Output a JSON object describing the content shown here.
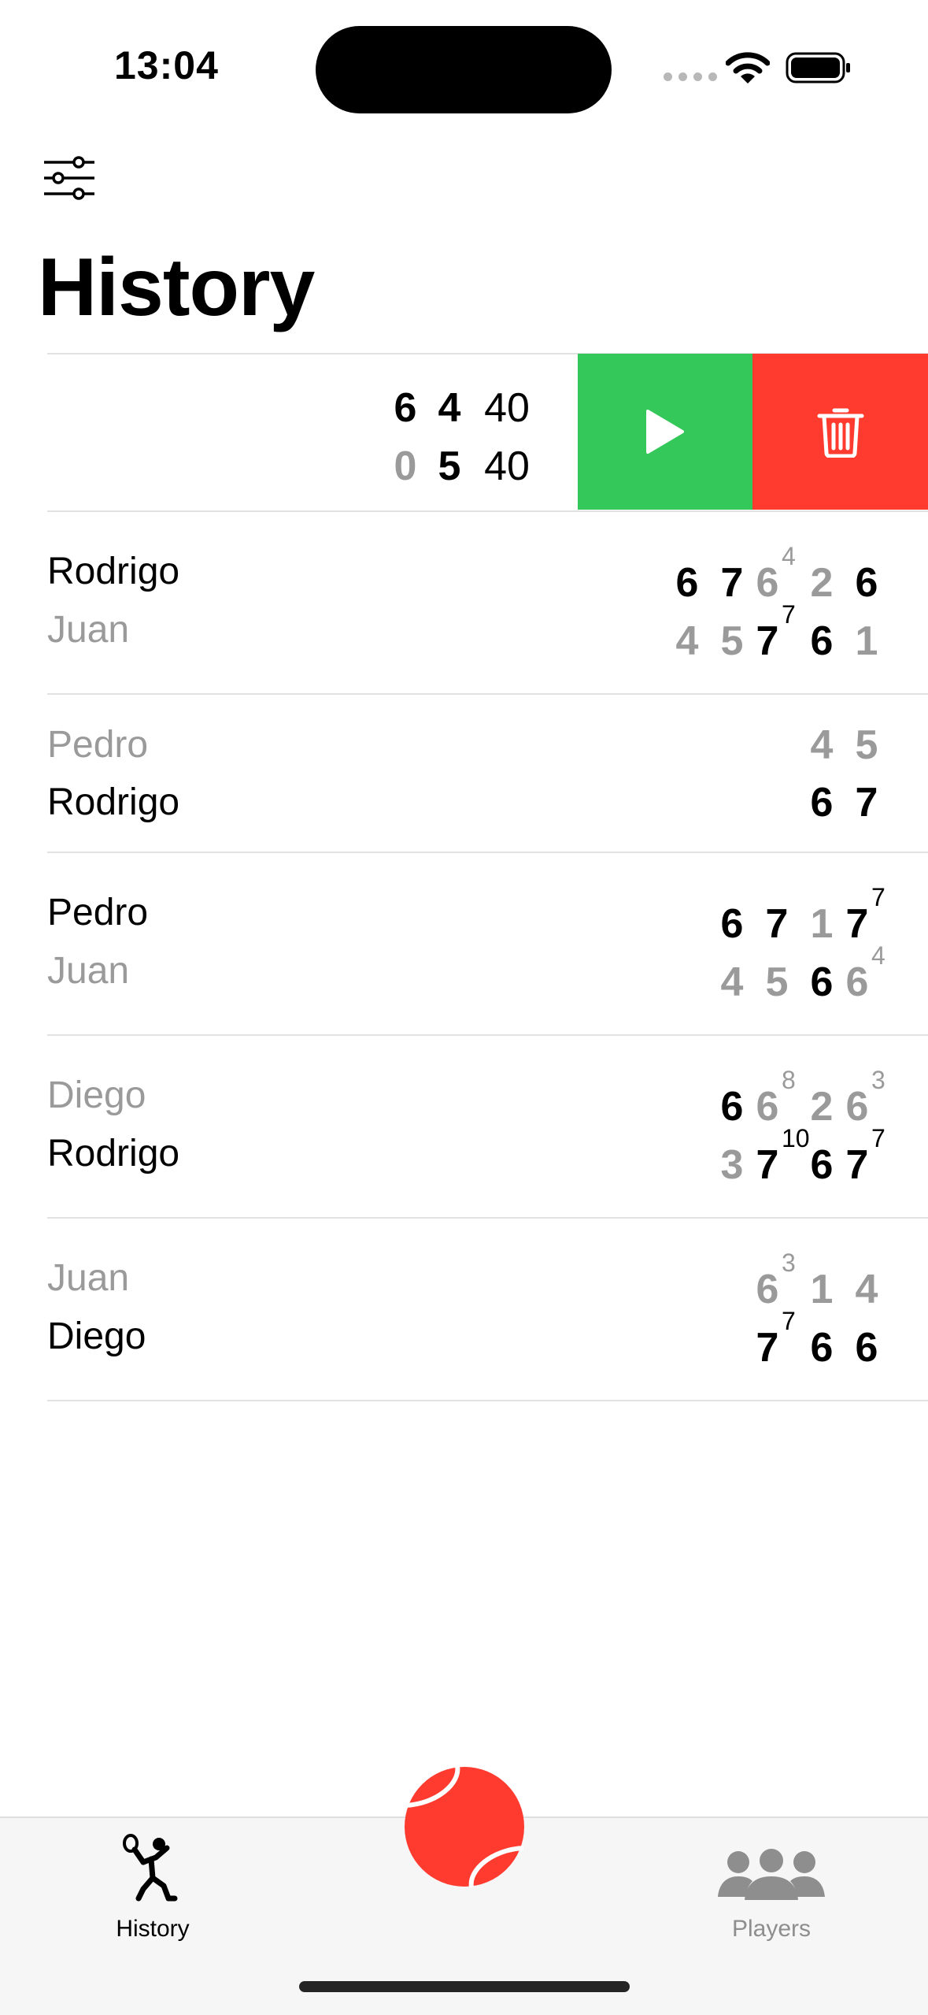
{
  "status_bar": {
    "time": "13:04"
  },
  "header": {
    "title": "History"
  },
  "live_match": {
    "rows": [
      {
        "scores": [
          "6",
          "4",
          "40"
        ],
        "state": [
          "w",
          "w",
          "pt"
        ]
      },
      {
        "scores": [
          "0",
          "5",
          "40"
        ],
        "state": [
          "l",
          "w",
          "pt"
        ]
      }
    ],
    "actions": {
      "resume": "play-icon",
      "delete": "trash-icon",
      "resume_color": "#34c759",
      "delete_color": "#ff3b30"
    }
  },
  "matches": [
    {
      "players": [
        {
          "name": "Rodrigo",
          "winner": true,
          "sets": [
            {
              "g": "6",
              "w": true
            },
            {
              "g": "7",
              "w": true
            },
            {
              "g": "6",
              "w": false,
              "tb": "4"
            },
            {
              "g": "2",
              "w": false
            },
            {
              "g": "6",
              "w": true
            }
          ]
        },
        {
          "name": "Juan",
          "winner": false,
          "sets": [
            {
              "g": "4",
              "w": false
            },
            {
              "g": "5",
              "w": false
            },
            {
              "g": "7",
              "w": true,
              "tb": "7"
            },
            {
              "g": "6",
              "w": true
            },
            {
              "g": "1",
              "w": false
            }
          ]
        }
      ]
    },
    {
      "players": [
        {
          "name": "Pedro",
          "winner": false,
          "sets": [
            {
              "g": "4",
              "w": false
            },
            {
              "g": "5",
              "w": false
            }
          ]
        },
        {
          "name": "Rodrigo",
          "winner": true,
          "sets": [
            {
              "g": "6",
              "w": true
            },
            {
              "g": "7",
              "w": true
            }
          ]
        }
      ]
    },
    {
      "players": [
        {
          "name": "Pedro",
          "winner": true,
          "sets": [
            {
              "g": "6",
              "w": true
            },
            {
              "g": "7",
              "w": true
            },
            {
              "g": "1",
              "w": false
            },
            {
              "g": "7",
              "w": true,
              "tb": "7"
            }
          ]
        },
        {
          "name": "Juan",
          "winner": false,
          "sets": [
            {
              "g": "4",
              "w": false
            },
            {
              "g": "5",
              "w": false
            },
            {
              "g": "6",
              "w": true
            },
            {
              "g": "6",
              "w": false,
              "tb": "4"
            }
          ]
        }
      ]
    },
    {
      "players": [
        {
          "name": "Diego",
          "winner": false,
          "sets": [
            {
              "g": "6",
              "w": true
            },
            {
              "g": "6",
              "w": false,
              "tb": "8"
            },
            {
              "g": "2",
              "w": false
            },
            {
              "g": "6",
              "w": false,
              "tb": "3"
            }
          ]
        },
        {
          "name": "Rodrigo",
          "winner": true,
          "sets": [
            {
              "g": "3",
              "w": false
            },
            {
              "g": "7",
              "w": true,
              "tb": "10"
            },
            {
              "g": "6",
              "w": true
            },
            {
              "g": "7",
              "w": true,
              "tb": "7"
            }
          ]
        }
      ]
    },
    {
      "players": [
        {
          "name": "Juan",
          "winner": false,
          "sets": [
            {
              "g": "6",
              "w": false,
              "tb": "3"
            },
            {
              "g": "1",
              "w": false
            },
            {
              "g": "4",
              "w": false
            }
          ]
        },
        {
          "name": "Diego",
          "winner": true,
          "sets": [
            {
              "g": "7",
              "w": true,
              "tb": "7"
            },
            {
              "g": "6",
              "w": true
            },
            {
              "g": "6",
              "w": true
            }
          ]
        }
      ]
    }
  ],
  "tabbar": {
    "history_label": "History",
    "players_label": "Players",
    "center_button": "tennis-ball-icon",
    "accent": "#ff3b30"
  }
}
